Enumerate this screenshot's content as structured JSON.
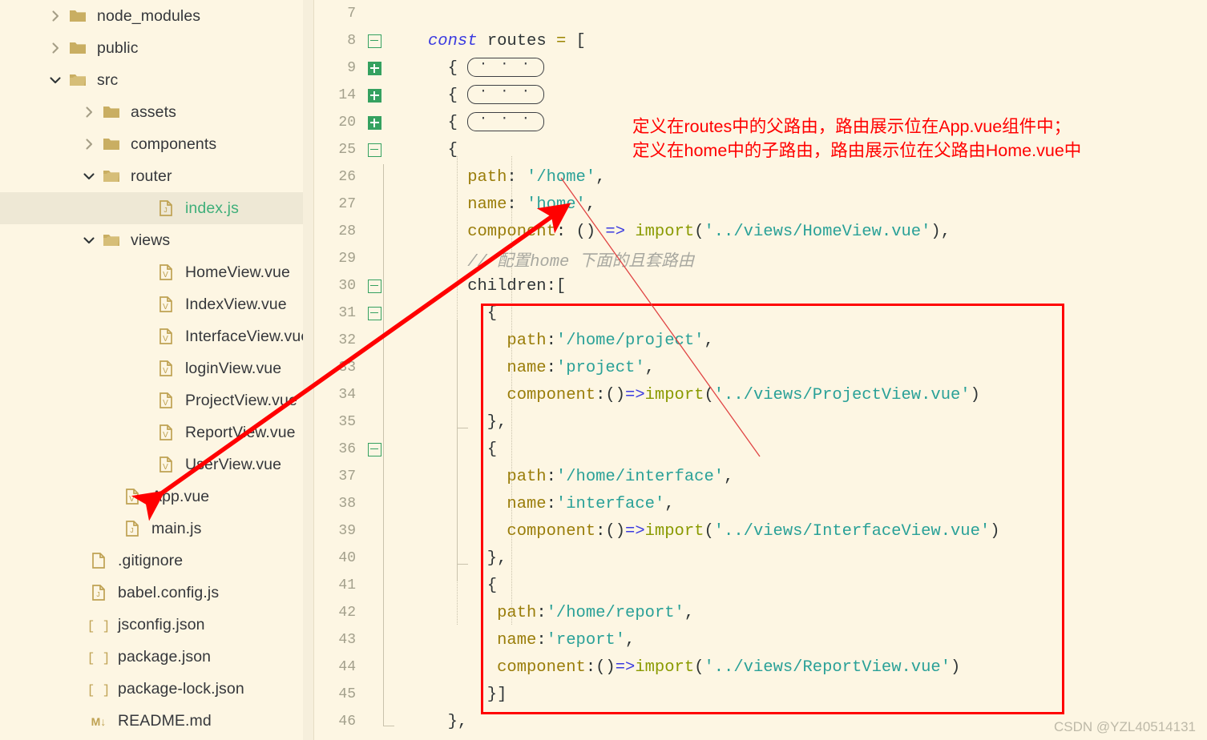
{
  "sidebar": {
    "items": [
      {
        "label": "node_modules",
        "icon": "folder-icon",
        "twisty": "chevron-right-icon",
        "indent": 56,
        "type": "folder",
        "selected": false
      },
      {
        "label": "public",
        "icon": "folder-icon",
        "twisty": "chevron-right-icon",
        "indent": 56,
        "type": "folder",
        "selected": false
      },
      {
        "label": "src",
        "icon": "folder-open-icon",
        "twisty": "chevron-down-icon",
        "indent": 56,
        "type": "folder",
        "selected": false
      },
      {
        "label": "assets",
        "icon": "folder-icon",
        "twisty": "chevron-right-icon",
        "indent": 98,
        "type": "folder",
        "selected": false
      },
      {
        "label": "components",
        "icon": "folder-icon",
        "twisty": "chevron-right-icon",
        "indent": 98,
        "type": "folder",
        "selected": false
      },
      {
        "label": "router",
        "icon": "folder-open-icon",
        "twisty": "chevron-down-icon",
        "indent": 98,
        "type": "folder",
        "selected": false
      },
      {
        "label": "index.js",
        "icon": "js-file-icon",
        "twisty": "none",
        "indent": 166,
        "type": "js",
        "selected": true
      },
      {
        "label": "views",
        "icon": "folder-open-icon",
        "twisty": "chevron-down-icon",
        "indent": 98,
        "type": "folder",
        "selected": false
      },
      {
        "label": "HomeView.vue",
        "icon": "vue-file-icon",
        "twisty": "none",
        "indent": 166,
        "type": "vue",
        "selected": false
      },
      {
        "label": "IndexView.vue",
        "icon": "vue-file-icon",
        "twisty": "none",
        "indent": 166,
        "type": "vue",
        "selected": false
      },
      {
        "label": "InterfaceView.vue",
        "icon": "vue-file-icon",
        "twisty": "none",
        "indent": 166,
        "type": "vue",
        "selected": false
      },
      {
        "label": "loginView.vue",
        "icon": "vue-file-icon",
        "twisty": "none",
        "indent": 166,
        "type": "vue",
        "selected": false
      },
      {
        "label": "ProjectView.vue",
        "icon": "vue-file-icon",
        "twisty": "none",
        "indent": 166,
        "type": "vue",
        "selected": false
      },
      {
        "label": "ReportView.vue",
        "icon": "vue-file-icon",
        "twisty": "none",
        "indent": 166,
        "type": "vue",
        "selected": false
      },
      {
        "label": "UserView.vue",
        "icon": "vue-file-icon",
        "twisty": "none",
        "indent": 166,
        "type": "vue",
        "selected": false
      },
      {
        "label": "App.vue",
        "icon": "vue-file-icon",
        "twisty": "none",
        "indent": 124,
        "type": "vue",
        "selected": false
      },
      {
        "label": "main.js",
        "icon": "js-file-icon",
        "twisty": "none",
        "indent": 124,
        "type": "js",
        "selected": false
      },
      {
        "label": ".gitignore",
        "icon": "blank-file-icon",
        "twisty": "none",
        "indent": 82,
        "type": "plain",
        "selected": false
      },
      {
        "label": "babel.config.js",
        "icon": "js-file-icon",
        "twisty": "none",
        "indent": 82,
        "type": "js",
        "selected": false
      },
      {
        "label": "jsconfig.json",
        "icon": "json-file-icon",
        "twisty": "none",
        "indent": 82,
        "type": "json",
        "selected": false
      },
      {
        "label": "package.json",
        "icon": "json-file-icon",
        "twisty": "none",
        "indent": 82,
        "type": "json",
        "selected": false
      },
      {
        "label": "package-lock.json",
        "icon": "json-file-icon",
        "twisty": "none",
        "indent": 82,
        "type": "json",
        "selected": false
      },
      {
        "label": "README.md",
        "icon": "markdown-file-icon",
        "twisty": "none",
        "indent": 82,
        "type": "md",
        "selected": false
      }
    ]
  },
  "editor": {
    "lines": [
      {
        "num": "7",
        "fold": "none",
        "indent": 0,
        "tokens": []
      },
      {
        "num": "8",
        "fold": "minus",
        "indent": 0,
        "tokens": [
          {
            "t": "const ",
            "c": "kw"
          },
          {
            "t": "routes ",
            "c": "ident"
          },
          {
            "t": "= ",
            "c": "op"
          },
          {
            "t": "[",
            "c": "punct"
          }
        ]
      },
      {
        "num": "9",
        "fold": "plus",
        "indent": 1,
        "tokens": [
          {
            "t": "{",
            "c": "punct"
          }
        ],
        "pill": "· · ·"
      },
      {
        "num": "14",
        "fold": "plus",
        "indent": 1,
        "tokens": [
          {
            "t": "{",
            "c": "punct"
          }
        ],
        "pill": "· · ·"
      },
      {
        "num": "20",
        "fold": "plus",
        "indent": 1,
        "tokens": [
          {
            "t": "{",
            "c": "punct"
          }
        ],
        "pill": "· · ·"
      },
      {
        "num": "25",
        "fold": "minus",
        "indent": 1,
        "tokens": [
          {
            "t": "{",
            "c": "punct"
          }
        ]
      },
      {
        "num": "26",
        "fold": "none",
        "indent": 2,
        "tokens": [
          {
            "t": "path",
            "c": "prop"
          },
          {
            "t": ": ",
            "c": "punct"
          },
          {
            "t": "'/home'",
            "c": "str"
          },
          {
            "t": ",",
            "c": "punct"
          }
        ]
      },
      {
        "num": "27",
        "fold": "none",
        "indent": 2,
        "tokens": [
          {
            "t": "name",
            "c": "prop"
          },
          {
            "t": ": ",
            "c": "punct"
          },
          {
            "t": "'home'",
            "c": "str"
          },
          {
            "t": ",",
            "c": "punct"
          }
        ]
      },
      {
        "num": "28",
        "fold": "none",
        "indent": 2,
        "tokens": [
          {
            "t": "component",
            "c": "prop"
          },
          {
            "t": ": ",
            "c": "punct"
          },
          {
            "t": "() ",
            "c": "punct"
          },
          {
            "t": "=> ",
            "c": "arrowop"
          },
          {
            "t": "import",
            "c": "fn"
          },
          {
            "t": "(",
            "c": "punct"
          },
          {
            "t": "'../views/HomeView.vue'",
            "c": "str"
          },
          {
            "t": "),",
            "c": "punct"
          }
        ]
      },
      {
        "num": "29",
        "fold": "none",
        "indent": 2,
        "tokens": [
          {
            "t": "// 配置home 下面的且套路由",
            "c": "cmt"
          }
        ]
      },
      {
        "num": "30",
        "fold": "minus",
        "indent": 2,
        "tokens": [
          {
            "t": "children",
            "c": "ident"
          },
          {
            "t": ":[",
            "c": "punct"
          }
        ]
      },
      {
        "num": "31",
        "fold": "minus",
        "indent": 3,
        "tokens": [
          {
            "t": "{",
            "c": "punct"
          }
        ]
      },
      {
        "num": "32",
        "fold": "none",
        "indent": 4,
        "tokens": [
          {
            "t": "path",
            "c": "prop"
          },
          {
            "t": ":",
            "c": "punct"
          },
          {
            "t": "'/home/project'",
            "c": "str"
          },
          {
            "t": ",",
            "c": "punct"
          }
        ]
      },
      {
        "num": "33",
        "fold": "none",
        "indent": 4,
        "tokens": [
          {
            "t": "name",
            "c": "prop"
          },
          {
            "t": ":",
            "c": "punct"
          },
          {
            "t": "'project'",
            "c": "str"
          },
          {
            "t": ",",
            "c": "punct"
          }
        ]
      },
      {
        "num": "34",
        "fold": "none",
        "indent": 4,
        "tokens": [
          {
            "t": "component",
            "c": "prop"
          },
          {
            "t": ":()",
            "c": "punct"
          },
          {
            "t": "=>",
            "c": "arrowop"
          },
          {
            "t": "import",
            "c": "fn"
          },
          {
            "t": "(",
            "c": "punct"
          },
          {
            "t": "'../views/ProjectView.vue'",
            "c": "str"
          },
          {
            "t": ")",
            "c": "punct"
          }
        ]
      },
      {
        "num": "35",
        "fold": "none",
        "indent": 3,
        "tokens": [
          {
            "t": "},",
            "c": "punct"
          }
        ]
      },
      {
        "num": "36",
        "fold": "minus",
        "indent": 3,
        "tokens": [
          {
            "t": "{",
            "c": "punct"
          }
        ]
      },
      {
        "num": "37",
        "fold": "none",
        "indent": 4,
        "tokens": [
          {
            "t": "path",
            "c": "prop"
          },
          {
            "t": ":",
            "c": "punct"
          },
          {
            "t": "'/home/interface'",
            "c": "str"
          },
          {
            "t": ",",
            "c": "punct"
          }
        ]
      },
      {
        "num": "38",
        "fold": "none",
        "indent": 4,
        "tokens": [
          {
            "t": "name",
            "c": "prop"
          },
          {
            "t": ":",
            "c": "punct"
          },
          {
            "t": "'interface'",
            "c": "str"
          },
          {
            "t": ",",
            "c": "punct"
          }
        ]
      },
      {
        "num": "39",
        "fold": "none",
        "indent": 4,
        "tokens": [
          {
            "t": "component",
            "c": "prop"
          },
          {
            "t": ":()",
            "c": "punct"
          },
          {
            "t": "=>",
            "c": "arrowop"
          },
          {
            "t": "import",
            "c": "fn"
          },
          {
            "t": "(",
            "c": "punct"
          },
          {
            "t": "'../views/InterfaceView.vue'",
            "c": "str"
          },
          {
            "t": ")",
            "c": "punct"
          }
        ]
      },
      {
        "num": "40",
        "fold": "none",
        "indent": 3,
        "tokens": [
          {
            "t": "},",
            "c": "punct"
          }
        ]
      },
      {
        "num": "41",
        "fold": "none",
        "indent": 3,
        "tokens": [
          {
            "t": "{",
            "c": "punct"
          }
        ]
      },
      {
        "num": "42",
        "fold": "none",
        "indent": 3.5,
        "tokens": [
          {
            "t": "path",
            "c": "prop"
          },
          {
            "t": ":",
            "c": "punct"
          },
          {
            "t": "'/home/report'",
            "c": "str"
          },
          {
            "t": ",",
            "c": "punct"
          }
        ]
      },
      {
        "num": "43",
        "fold": "none",
        "indent": 3.5,
        "tokens": [
          {
            "t": "name",
            "c": "prop"
          },
          {
            "t": ":",
            "c": "punct"
          },
          {
            "t": "'report'",
            "c": "str"
          },
          {
            "t": ",",
            "c": "punct"
          }
        ]
      },
      {
        "num": "44",
        "fold": "none",
        "indent": 3.5,
        "tokens": [
          {
            "t": "component",
            "c": "prop"
          },
          {
            "t": ":()",
            "c": "punct"
          },
          {
            "t": "=>",
            "c": "arrowop"
          },
          {
            "t": "import",
            "c": "fn"
          },
          {
            "t": "(",
            "c": "punct"
          },
          {
            "t": "'../views/ReportView.vue'",
            "c": "str"
          },
          {
            "t": ")",
            "c": "punct"
          }
        ]
      },
      {
        "num": "45",
        "fold": "none",
        "indent": 3,
        "tokens": [
          {
            "t": "}]",
            "c": "punct"
          }
        ]
      },
      {
        "num": "46",
        "fold": "none",
        "indent": 1,
        "tokens": [
          {
            "t": "},",
            "c": "punct"
          }
        ]
      }
    ]
  },
  "annotation": {
    "line1": "定义在routes中的父路由，路由展示位在App.vue组件中；",
    "line2": "定义在home中的子路由，路由展示位在父路由Home.vue中",
    "color": "#FF0000"
  },
  "watermark": "CSDN @YZL40514131"
}
